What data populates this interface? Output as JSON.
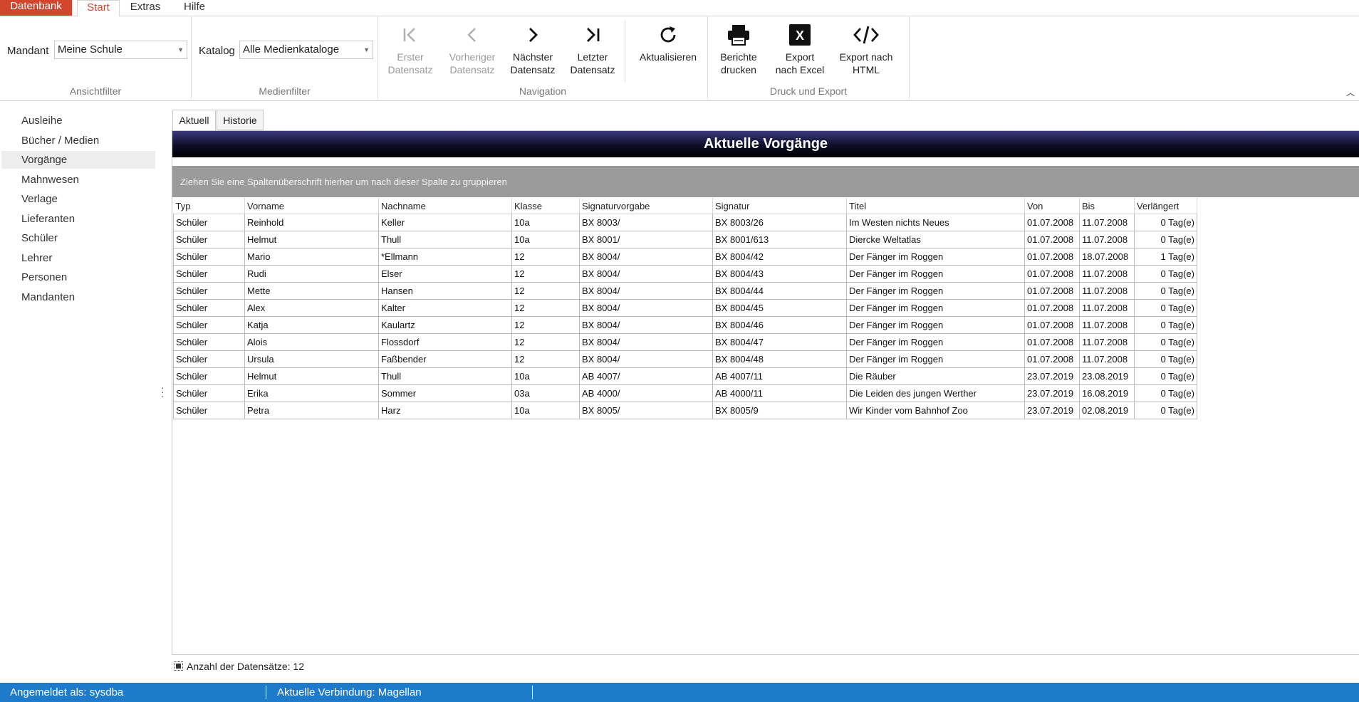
{
  "ribbon_tabs": {
    "datenbank": "Datenbank",
    "start": "Start",
    "extras": "Extras",
    "hilfe": "Hilfe"
  },
  "ansichtfilter": {
    "mandant_label": "Mandant",
    "mandant_value": "Meine Schule",
    "group_label": "Ansichtfilter"
  },
  "medienfilter": {
    "katalog_label": "Katalog",
    "katalog_value": "Alle Medienkataloge",
    "group_label": "Medienfilter"
  },
  "navigation": {
    "group_label": "Navigation",
    "first": [
      "Erster",
      "Datensatz"
    ],
    "prev": [
      "Vorheriger",
      "Datensatz"
    ],
    "next": [
      "Nächster",
      "Datensatz"
    ],
    "last": [
      "Letzter",
      "Datensatz"
    ],
    "refresh": "Aktualisieren"
  },
  "druck_export": {
    "group_label": "Druck und Export",
    "print": [
      "Berichte",
      "drucken"
    ],
    "excel": [
      "Export",
      "nach Excel"
    ],
    "html": [
      "Export nach",
      "HTML"
    ]
  },
  "sidebar": {
    "items": [
      "Ausleihe",
      "Bücher / Medien",
      "Vorgänge",
      "Mahnwesen",
      "Verlage",
      "Lieferanten",
      "Schüler",
      "Lehrer",
      "Personen",
      "Mandanten"
    ],
    "selected": "Vorgänge"
  },
  "content_tabs": {
    "aktuell": "Aktuell",
    "historie": "Historie"
  },
  "panel_title": "Aktuelle Vorgänge",
  "group_hint": "Ziehen Sie eine Spaltenüberschrift hierher um nach dieser Spalte zu gruppieren",
  "table": {
    "columns": [
      "Typ",
      "Vorname",
      "Nachname",
      "Klasse",
      "Signaturvorgabe",
      "Signatur",
      "Titel",
      "Von",
      "Bis",
      "Verlängert"
    ],
    "rows": [
      [
        "Schüler",
        "Reinhold",
        "Keller",
        "10a",
        "BX 8003/",
        "BX 8003/26",
        "Im Westen nichts Neues",
        "01.07.2008",
        "11.07.2008",
        "0 Tag(e)"
      ],
      [
        "Schüler",
        "Helmut",
        "Thull",
        "10a",
        "BX 8001/",
        "BX 8001/613",
        "Diercke Weltatlas",
        "01.07.2008",
        "11.07.2008",
        "0 Tag(e)"
      ],
      [
        "Schüler",
        "Mario",
        "*Ellmann",
        "12",
        "BX 8004/",
        "BX 8004/42",
        "Der Fänger im Roggen",
        "01.07.2008",
        "18.07.2008",
        "1 Tag(e)"
      ],
      [
        "Schüler",
        "Rudi",
        "Elser",
        "12",
        "BX 8004/",
        "BX 8004/43",
        "Der Fänger im Roggen",
        "01.07.2008",
        "11.07.2008",
        "0 Tag(e)"
      ],
      [
        "Schüler",
        "Mette",
        "Hansen",
        "12",
        "BX 8004/",
        "BX 8004/44",
        "Der Fänger im Roggen",
        "01.07.2008",
        "11.07.2008",
        "0 Tag(e)"
      ],
      [
        "Schüler",
        "Alex",
        "Kalter",
        "12",
        "BX 8004/",
        "BX 8004/45",
        "Der Fänger im Roggen",
        "01.07.2008",
        "11.07.2008",
        "0 Tag(e)"
      ],
      [
        "Schüler",
        "Katja",
        "Kaulartz",
        "12",
        "BX 8004/",
        "BX 8004/46",
        "Der Fänger im Roggen",
        "01.07.2008",
        "11.07.2008",
        "0 Tag(e)"
      ],
      [
        "Schüler",
        "Alois",
        "Flossdorf",
        "12",
        "BX 8004/",
        "BX 8004/47",
        "Der Fänger im Roggen",
        "01.07.2008",
        "11.07.2008",
        "0 Tag(e)"
      ],
      [
        "Schüler",
        "Ursula",
        "Faßbender",
        "12",
        "BX 8004/",
        "BX 8004/48",
        "Der Fänger im Roggen",
        "01.07.2008",
        "11.07.2008",
        "0 Tag(e)"
      ],
      [
        "Schüler",
        "Helmut",
        "Thull",
        "10a",
        "AB 4007/",
        "AB 4007/11",
        "Die Räuber",
        "23.07.2019",
        "23.08.2019",
        "0 Tag(e)"
      ],
      [
        "Schüler",
        "Erika",
        "Sommer",
        "03a",
        "AB 4000/",
        "AB 4000/11",
        "Die Leiden des jungen Werther",
        "23.07.2019",
        "16.08.2019",
        "0 Tag(e)"
      ],
      [
        "Schüler",
        "Petra",
        "Harz",
        "10a",
        "BX 8005/",
        "BX 8005/9",
        "Wir Kinder vom Bahnhof Zoo",
        "23.07.2019",
        "02.08.2019",
        "0 Tag(e)"
      ]
    ]
  },
  "record_count": "Anzahl der Datensätze: 12",
  "status": {
    "user": "Angemeldet als: sysdba",
    "connection": "Aktuelle Verbindung: Magellan"
  },
  "colors": {
    "accent": "#d2462e",
    "statusbar": "#1e7bcb",
    "title_gradient_top": "#3c3a7d",
    "group_panel": "#9b9b9b"
  }
}
